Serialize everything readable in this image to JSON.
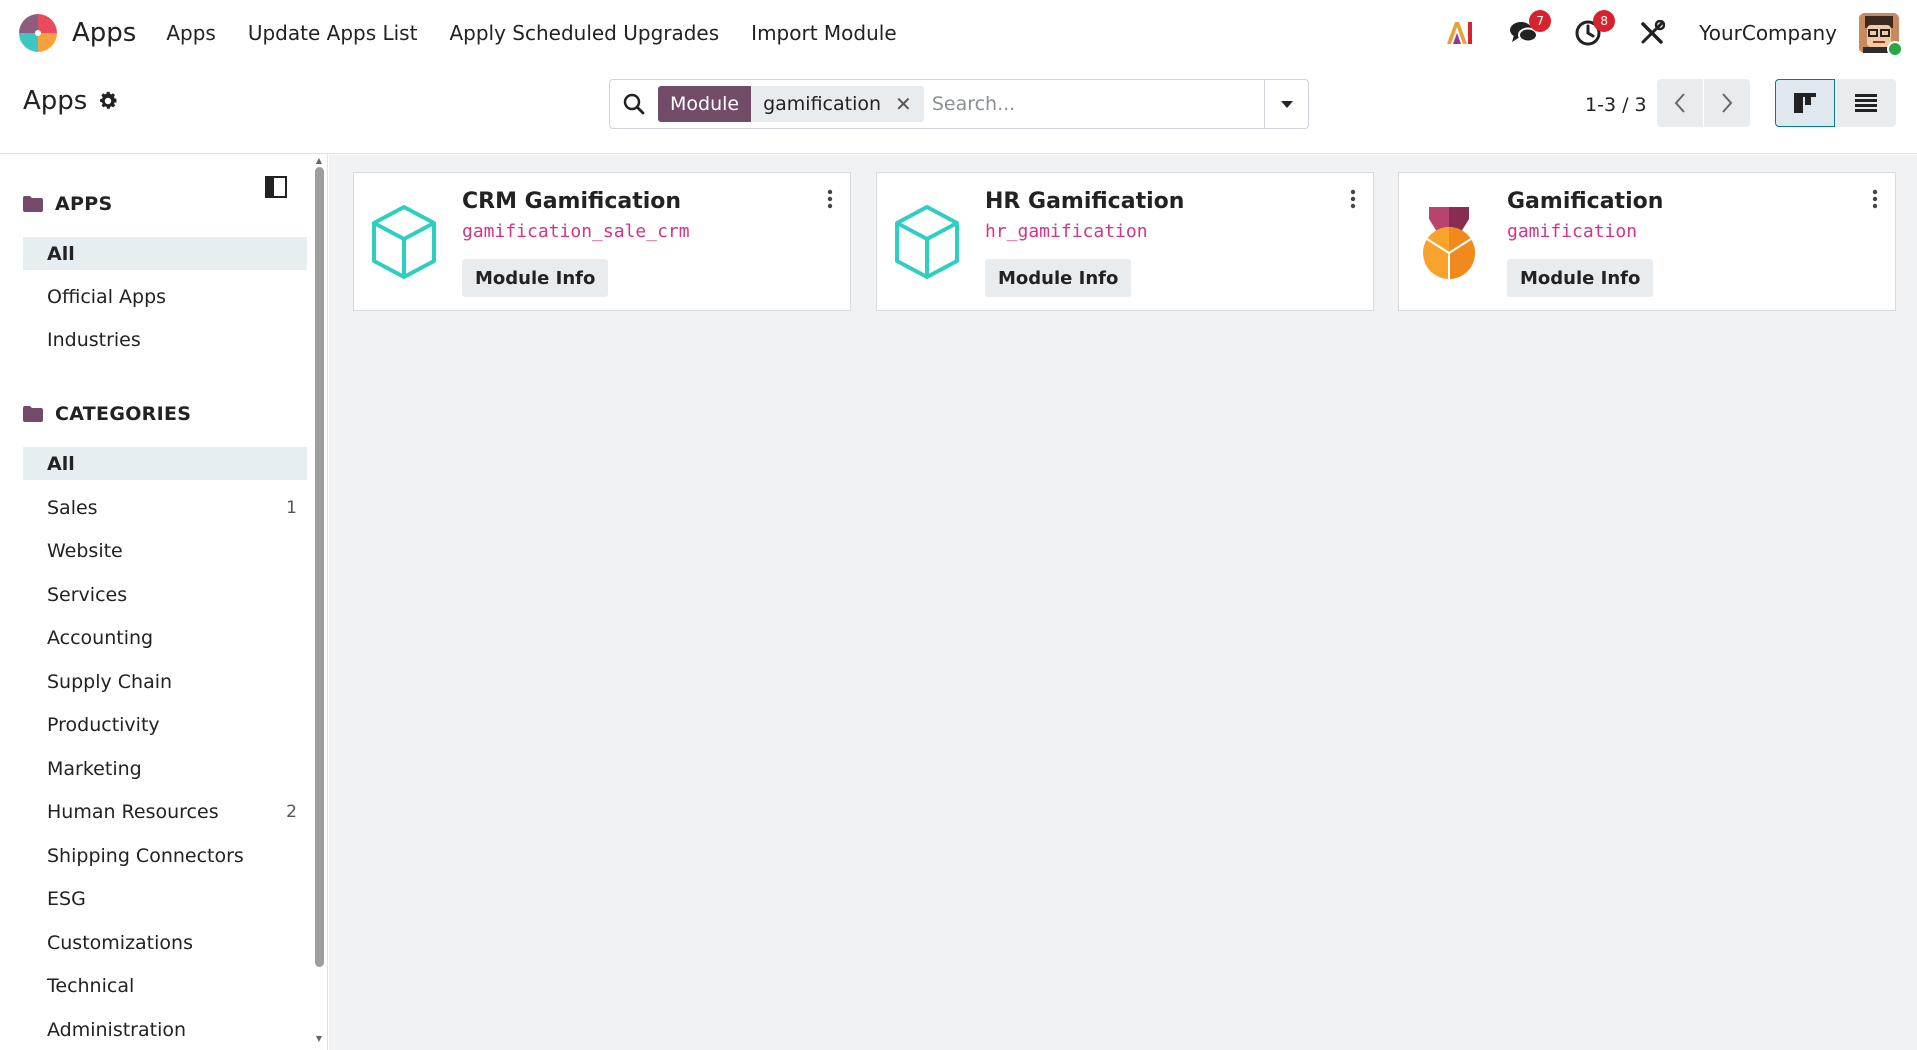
{
  "navbar": {
    "brand": "Apps",
    "links": [
      "Apps",
      "Update Apps List",
      "Apply Scheduled Upgrades",
      "Import Module"
    ],
    "ai_label": "AI",
    "messages_count": "7",
    "activities_count": "8",
    "company": "YourCompany"
  },
  "control": {
    "breadcrumb": "Apps",
    "facet_label": "Module",
    "facet_value": "gamification",
    "search_placeholder": "Search...",
    "pager": "1-3 / 3"
  },
  "sidebar": {
    "apps_title": "APPS",
    "apps": [
      "All",
      "Official Apps",
      "Industries"
    ],
    "categories_title": "CATEGORIES",
    "categories": [
      {
        "label": "All",
        "count": ""
      },
      {
        "label": "Sales",
        "count": "1"
      },
      {
        "label": "Website",
        "count": ""
      },
      {
        "label": "Services",
        "count": ""
      },
      {
        "label": "Accounting",
        "count": ""
      },
      {
        "label": "Supply Chain",
        "count": ""
      },
      {
        "label": "Productivity",
        "count": ""
      },
      {
        "label": "Marketing",
        "count": ""
      },
      {
        "label": "Human Resources",
        "count": "2"
      },
      {
        "label": "Shipping Connectors",
        "count": ""
      },
      {
        "label": "ESG",
        "count": ""
      },
      {
        "label": "Customizations",
        "count": ""
      },
      {
        "label": "Technical",
        "count": ""
      },
      {
        "label": "Administration",
        "count": ""
      }
    ]
  },
  "cards": [
    {
      "title": "CRM Gamification",
      "technical": "gamification_sale_crm",
      "button": "Module Info",
      "icon": "cube-icon"
    },
    {
      "title": "HR Gamification",
      "technical": "hr_gamification",
      "button": "Module Info",
      "icon": "cube-icon"
    },
    {
      "title": "Gamification",
      "technical": "gamification",
      "button": "Module Info",
      "icon": "medal-icon"
    }
  ],
  "colors": {
    "brand_purple": "#714b67",
    "teal": "#2ecfc0",
    "tech_pink": "#d63384",
    "badge_red": "#d6232f"
  }
}
